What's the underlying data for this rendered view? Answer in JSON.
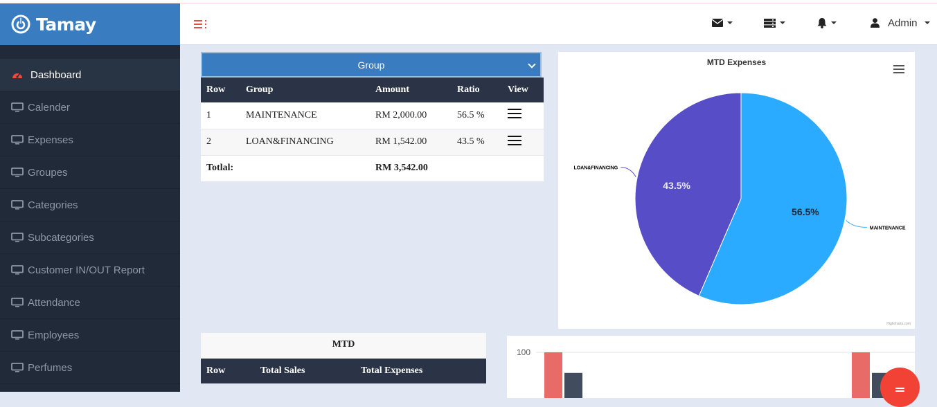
{
  "brand": {
    "name": "Tamay"
  },
  "topbar": {
    "icons": [
      "envelope-icon",
      "server-icon",
      "bell-icon",
      "user-icon"
    ],
    "admin_label": "Admin"
  },
  "sidebar": {
    "items": [
      {
        "label": "Dashboard",
        "icon": "dashboard-icon",
        "active": true
      },
      {
        "label": "Calender",
        "icon": "monitor-icon"
      },
      {
        "label": "Expenses",
        "icon": "monitor-icon"
      },
      {
        "label": "Groupes",
        "icon": "monitor-icon"
      },
      {
        "label": "Categories",
        "icon": "monitor-icon"
      },
      {
        "label": "Subcategories",
        "icon": "monitor-icon"
      },
      {
        "label": "Customer IN/OUT Report",
        "icon": "monitor-icon"
      },
      {
        "label": "Attendance",
        "icon": "monitor-icon"
      },
      {
        "label": "Employees",
        "icon": "monitor-icon"
      },
      {
        "label": "Perfumes",
        "icon": "monitor-icon"
      }
    ]
  },
  "group_select": {
    "value": "Group"
  },
  "group_table": {
    "headers": [
      "Row",
      "Group",
      "Amount",
      "Ratio",
      "View"
    ],
    "rows": [
      {
        "row": "1",
        "group": "MAINTENANCE",
        "amount": "RM 2,000.00",
        "ratio": "56.5 %"
      },
      {
        "row": "2",
        "group": "LOAN&FINANCING",
        "amount": "RM 1,542.00",
        "ratio": "43.5 %"
      }
    ],
    "total_label": "Totlal:",
    "total_amount": "RM 3,542.00"
  },
  "pie_chart": {
    "title": "MTD Expenses",
    "credit": "Highcharts.com",
    "chart_data": {
      "type": "pie",
      "title": "MTD Expenses",
      "slices": [
        {
          "label": "MAINTENANCE",
          "value": 56.5,
          "display": "56.5%",
          "color": "#2aabff"
        },
        {
          "label": "LOAN&FINANCING",
          "value": 43.5,
          "display": "43.5%",
          "color": "#574ec7"
        }
      ]
    }
  },
  "mtd_table": {
    "title": "MTD",
    "headers": [
      "Row",
      "Total Sales",
      "Total Expenses"
    ]
  },
  "bar_chart": {
    "chart_data": {
      "type": "bar",
      "y_tick": "100",
      "series": [
        {
          "values": [
            100,
            100
          ],
          "color": "#e96b67"
        },
        {
          "values": [
            69,
            69
          ],
          "color": "#414c5e"
        }
      ]
    }
  },
  "colors": {
    "brand": "#3a7cc0",
    "sidebar": "#212a38",
    "accent": "#f24236"
  }
}
